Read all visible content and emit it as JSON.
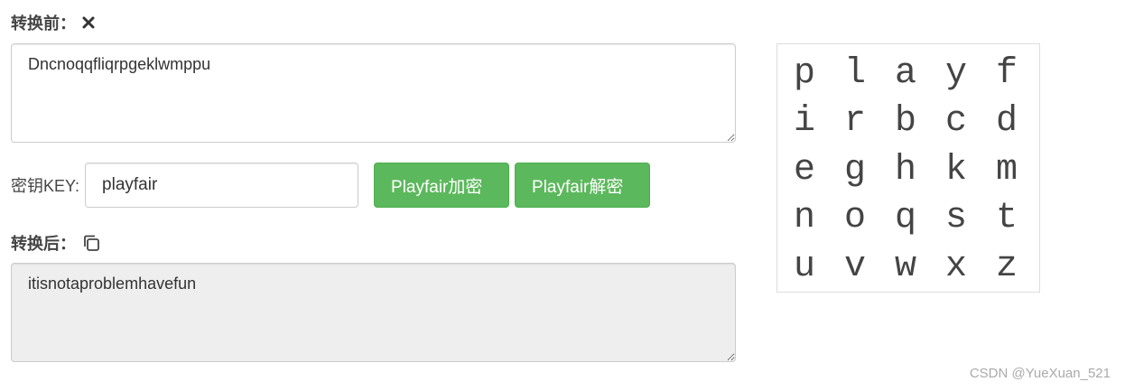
{
  "before": {
    "label": "转换前：",
    "clear_icon": "close-x-icon",
    "value": "Dncnoqqfliqrpgeklwmppu"
  },
  "key": {
    "label": "密钥KEY:",
    "value": "playfair"
  },
  "buttons": {
    "encrypt_label": "Playfair加密",
    "decrypt_label": "Playfair解密",
    "color": "#5cb85c"
  },
  "after": {
    "label": "转换后：",
    "copy_icon": "copy-icon",
    "value": "itisnotaproblemhavefun"
  },
  "matrix": {
    "rows": [
      [
        "p",
        "l",
        "a",
        "y",
        "f"
      ],
      [
        "i",
        "r",
        "b",
        "c",
        "d"
      ],
      [
        "e",
        "g",
        "h",
        "k",
        "m"
      ],
      [
        "n",
        "o",
        "q",
        "s",
        "t"
      ],
      [
        "u",
        "v",
        "w",
        "x",
        "z"
      ]
    ]
  },
  "watermark": "CSDN @YueXuan_521"
}
